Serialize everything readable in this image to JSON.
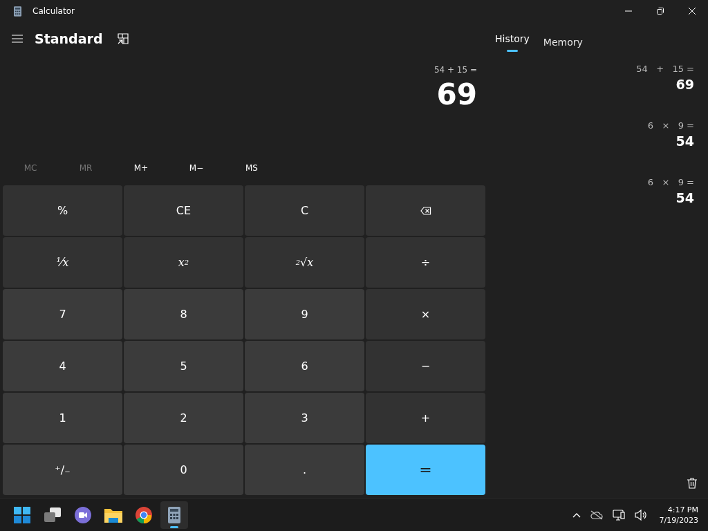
{
  "window": {
    "title": "Calculator"
  },
  "mode": {
    "title": "Standard"
  },
  "display": {
    "expression": "54 + 15 =",
    "value": "69"
  },
  "memory_buttons": [
    {
      "label": "MC",
      "disabled": true
    },
    {
      "label": "MR",
      "disabled": true
    },
    {
      "label": "M+",
      "disabled": false
    },
    {
      "label": "M−",
      "disabled": false
    },
    {
      "label": "MS",
      "disabled": false
    }
  ],
  "keys": [
    {
      "kind": "op",
      "label": "%"
    },
    {
      "kind": "op",
      "label": "CE"
    },
    {
      "kind": "op",
      "label": "C"
    },
    {
      "kind": "backspace"
    },
    {
      "kind": "func",
      "label": "⅟x"
    },
    {
      "kind": "func",
      "label": "x$^{2}$"
    },
    {
      "kind": "func",
      "label": "$^{2}$√x"
    },
    {
      "kind": "op",
      "label": "÷"
    },
    {
      "kind": "digit",
      "label": "7"
    },
    {
      "kind": "digit",
      "label": "8"
    },
    {
      "kind": "digit",
      "label": "9"
    },
    {
      "kind": "op",
      "label": "×"
    },
    {
      "kind": "digit",
      "label": "4"
    },
    {
      "kind": "digit",
      "label": "5"
    },
    {
      "kind": "digit",
      "label": "6"
    },
    {
      "kind": "op",
      "label": "−"
    },
    {
      "kind": "digit",
      "label": "1"
    },
    {
      "kind": "digit",
      "label": "2"
    },
    {
      "kind": "digit",
      "label": "3"
    },
    {
      "kind": "op",
      "label": "+"
    },
    {
      "kind": "digit",
      "label": "⁺∕₋"
    },
    {
      "kind": "digit",
      "label": "0"
    },
    {
      "kind": "digit",
      "label": "."
    },
    {
      "kind": "equals",
      "label": "="
    }
  ],
  "tabs": [
    {
      "label": "History",
      "selected": true
    },
    {
      "label": "Memory",
      "selected": false
    }
  ],
  "history": [
    {
      "expression": "54   +   15 =",
      "result": "69"
    },
    {
      "expression": "6   ×   9 =",
      "result": "54"
    },
    {
      "expression": "6   ×   9 =",
      "result": "54"
    }
  ],
  "taskbar": {
    "apps": [
      {
        "kind": "start",
        "active": false
      },
      {
        "kind": "taskview",
        "active": false
      },
      {
        "kind": "chat",
        "active": false
      },
      {
        "kind": "explorer",
        "active": false
      },
      {
        "kind": "browser",
        "active": false
      },
      {
        "kind": "calculator",
        "active": true
      }
    ],
    "time": "4:17 PM",
    "date": "7/19/2023"
  }
}
